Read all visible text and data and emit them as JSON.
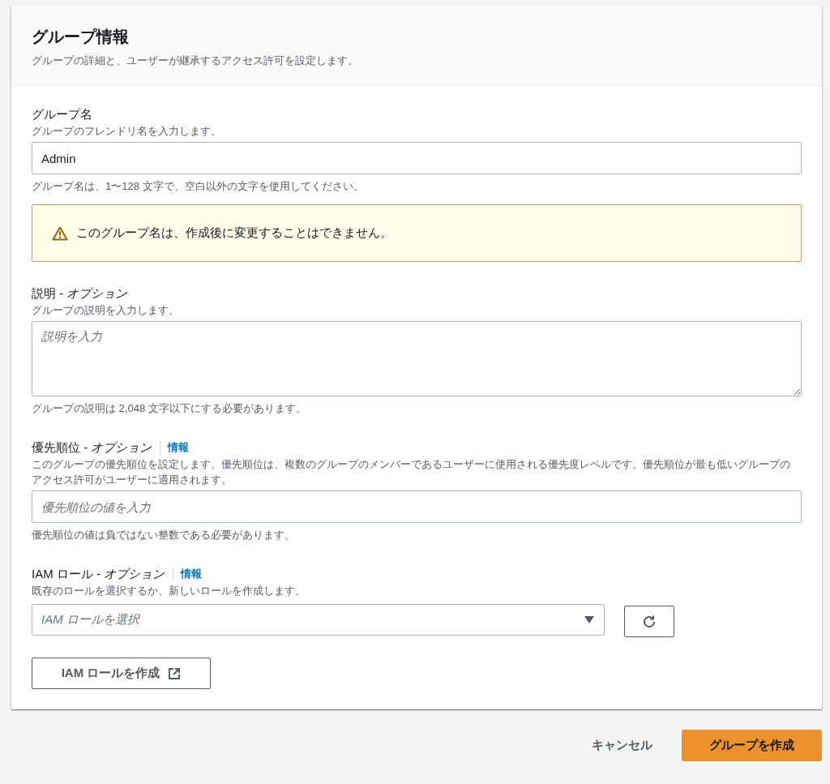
{
  "panel": {
    "title": "グループ情報",
    "description": "グループの詳細と、ユーザーが継承するアクセス許可を設定します。"
  },
  "fields": [
    {
      "kind": "text",
      "label": "グループ名",
      "description": "グループのフレンドリ名を入力します。",
      "value": "Admin",
      "constraint": "グループ名は、1〜128 文字で、空白以外の文字を使用してください。"
    },
    {
      "kind": "alert",
      "message": "このグループ名は、作成後に変更することはできません。"
    },
    {
      "kind": "textarea",
      "label": "説明 - *オプション*",
      "description": "グループの説明を入力します。",
      "placeholder": "説明を入力",
      "constraint": "グループの説明は 2,048 文字以下にする必要があります。"
    },
    {
      "kind": "text",
      "label": "優先順位 - *オプション*",
      "info": "情報",
      "description": "このグループの優先順位を設定します。優先順位は、複数のグループのメンバーであるユーザーに使用される優先度レベルです。優先順位が最も低いグループのアクセス許可がユーザーに適用されます。",
      "placeholder": "優先順位の値を入力",
      "constraint": "優先順位の値は負ではない整数である必要があります。"
    },
    {
      "kind": "select",
      "label": "IAM ロール - *オプション*",
      "info": "情報",
      "description": "既存のロールを選択するか、新しいロールを作成します。",
      "placeholder": "IAM ロールを選択",
      "action": "IAM ロールを作成"
    }
  ],
  "footer": [
    {
      "kind": "link",
      "label": "キャンセル"
    },
    {
      "kind": "primary",
      "label": "グループを作成"
    }
  ]
}
